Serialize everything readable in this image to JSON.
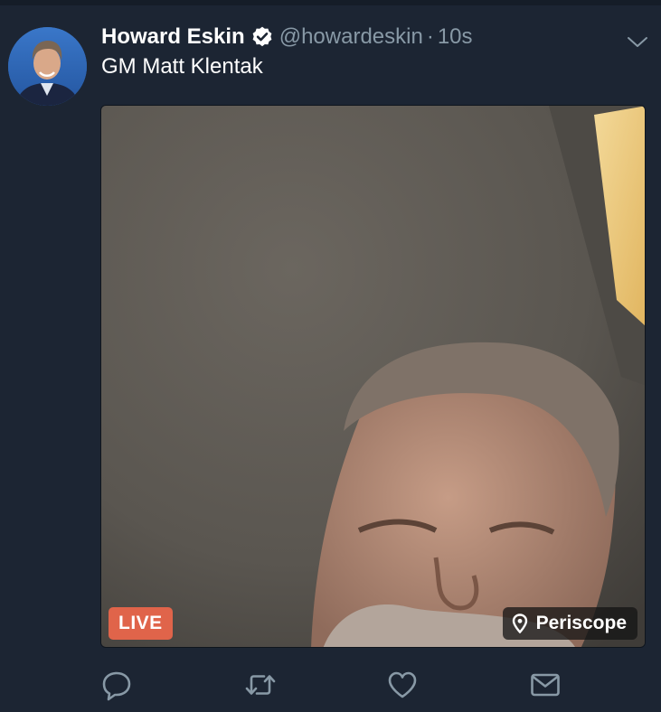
{
  "tweet": {
    "author": {
      "display_name": "Howard Eskin",
      "handle": "@howardeskin",
      "verified": true
    },
    "separator": "·",
    "timestamp": "10s",
    "text": "GM Matt Klentak"
  },
  "media": {
    "live_label": "LIVE",
    "source_label": "Periscope",
    "source_icon": "location-pin-icon"
  },
  "actions": {
    "reply_icon": "reply-icon",
    "retweet_icon": "retweet-icon",
    "like_icon": "like-icon",
    "dm_icon": "direct-message-icon"
  },
  "colors": {
    "background": "#1c2533",
    "live_badge": "#e0644a",
    "secondary_text": "#8899a6",
    "icon": "#8899a6"
  }
}
